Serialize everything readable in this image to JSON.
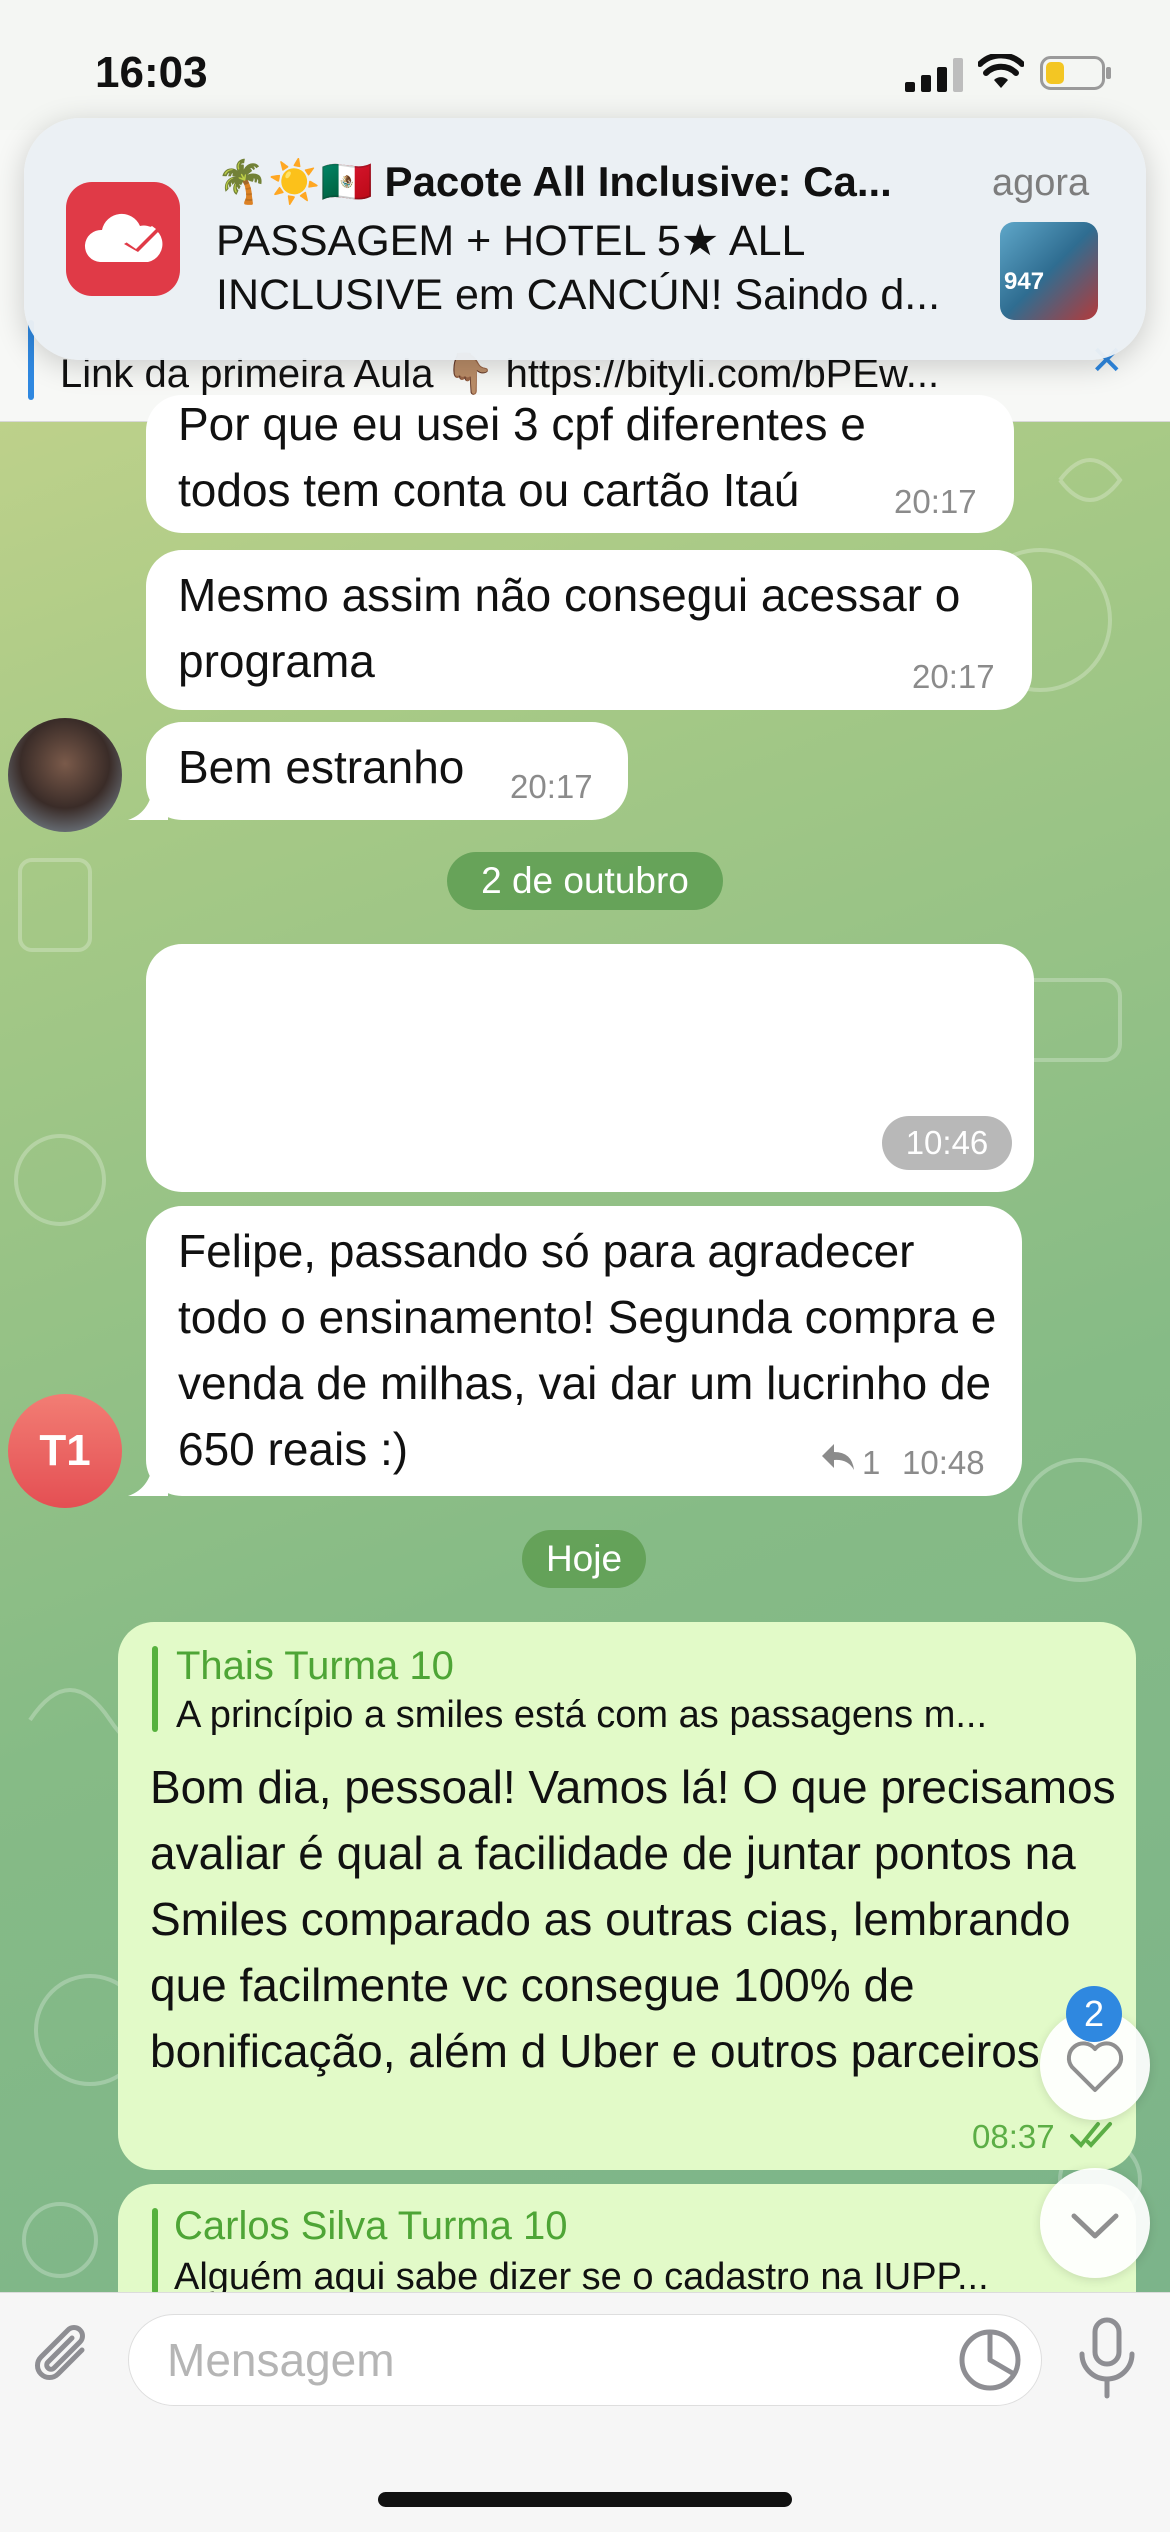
{
  "status_bar": {
    "time": "16:03"
  },
  "pinned": {
    "text": "Link da primeira Aula 👇🏽 https://bityli.com/bPEw..."
  },
  "notification": {
    "title": "🌴☀️🇲🇽 Pacote All Inclusive: Ca...",
    "time": "agora",
    "body": "PASSAGEM + HOTEL 5★ ALL INCLUSIVE em CANCÚN! Saindo d...",
    "thumb_text": "947",
    "app_icon": "plane-cloud-icon",
    "app_color": "#e03a47"
  },
  "messages": [
    {
      "text": "Por que eu usei 3 cpf diferentes e todos tem conta ou cartão Itaú",
      "time": "20:17"
    },
    {
      "text": "Mesmo assim não consegui acessar o programa",
      "time": "20:17"
    },
    {
      "text": "Bem estranho",
      "time": "20:17"
    },
    {
      "time": "10:46"
    },
    {
      "text": "Felipe, passando só para agradecer todo o ensinamento! Segunda compra e venda de milhas, vai dar um lucrinho de 650 reais :)",
      "replies": "1",
      "time": "10:48",
      "avatar": "T1"
    },
    {
      "reply_name": "Thais Turma 10",
      "reply_text": "A princípio a smiles está com as passagens m...",
      "text": "Bom dia, pessoal! Vamos lá! O que precisamos avaliar é qual a facilidade de juntar pontos na Smiles comparado as outras cias, lembrando que facilmente vc consegue 100% de bonificação, além d Uber e outros parceiros",
      "time": "08:37"
    },
    {
      "reply_name": "Carlos Silva Turma 10",
      "reply_text": "Alguém aqui sabe dizer se o cadastro na IUPP..."
    }
  ],
  "dates": {
    "first": "2 de outubro",
    "second": "Hoje"
  },
  "reactions_badge": "2",
  "composer": {
    "placeholder": "Mensagem"
  },
  "colors": {
    "accent": "#2f88e0",
    "outgoing_bubble": "#e2fac8",
    "date_pill": "#62a056"
  }
}
